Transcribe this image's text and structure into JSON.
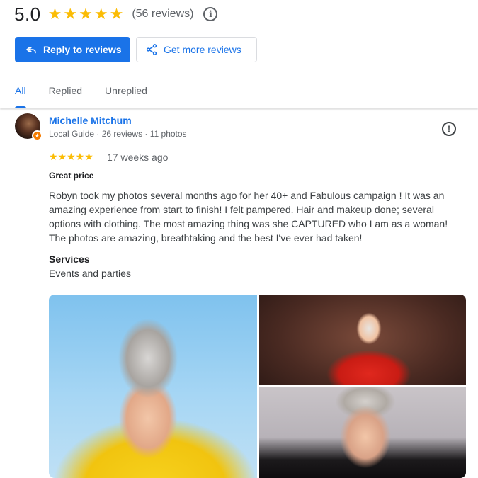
{
  "summary": {
    "rating": "5.0",
    "stars": [
      "★",
      "★",
      "★",
      "★",
      "★"
    ],
    "review_count": "(56 reviews)",
    "info_icon": "i"
  },
  "actions": {
    "reply_label": "Reply to reviews",
    "get_more_label": "Get more reviews"
  },
  "tabs": [
    {
      "label": "All",
      "active": true
    },
    {
      "label": "Replied",
      "active": false
    },
    {
      "label": "Unreplied",
      "active": false
    }
  ],
  "review": {
    "reviewer_name": "Michelle Mitchum",
    "reviewer_meta": "Local Guide · 26 reviews · 11 photos",
    "badge_icon": "★",
    "flag_icon": "!",
    "stars": "★★★★★",
    "time": "17 weeks ago",
    "title": "Great price",
    "body": "Robyn took my photos several months ago for her 40+ and Fabulous campaign ! It was an amazing experience from start to finish! I felt pampered. Hair and makeup done; several options with clothing. The most amazing thing was she CAPTURED who I am as a woman! The photos are amazing, breathtaking and the best I've ever had taken!",
    "services_label": "Services",
    "services_value": "Events and parties"
  },
  "colors": {
    "accent": "#1a73e8",
    "star": "#fbbc04",
    "badge": "#f57c00"
  },
  "icons": {
    "reply": "reply-icon",
    "share": "share-icon",
    "info": "info-icon",
    "flag": "report-icon"
  }
}
